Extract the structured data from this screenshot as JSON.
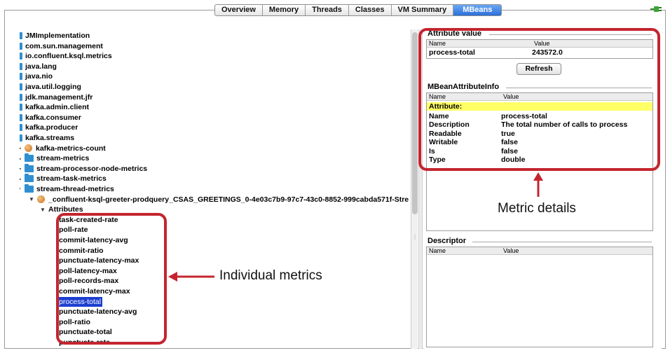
{
  "tabs": [
    {
      "label": "Overview",
      "active": false
    },
    {
      "label": "Memory",
      "active": false
    },
    {
      "label": "Threads",
      "active": false
    },
    {
      "label": "Classes",
      "active": false
    },
    {
      "label": "VM Summary",
      "active": false
    },
    {
      "label": "MBeans",
      "active": true
    }
  ],
  "tree": {
    "domains": [
      "JMImplementation",
      "com.sun.management",
      "io.confluent.ksql.metrics",
      "java.lang",
      "java.nio",
      "java.util.logging",
      "jdk.management.jfr",
      "kafka.admin.client",
      "kafka.consumer",
      "kafka.producer"
    ],
    "expanded_domain": "kafka.streams",
    "children": [
      {
        "label": "kafka-metrics-count",
        "icon": "bean-icon"
      },
      {
        "label": "stream-metrics",
        "icon": "folder-icon"
      },
      {
        "label": "stream-processor-node-metrics",
        "icon": "folder-icon"
      },
      {
        "label": "stream-task-metrics",
        "icon": "folder-icon"
      }
    ],
    "expanded_child": "stream-thread-metrics",
    "thread_bean": "_confluent-ksql-greeter-prodquery_CSAS_GREETINGS_0-4e03c7b9-97c7-43c0-8852-999cabda571f-Stre",
    "attributes_node": "Attributes",
    "attributes": [
      "task-created-rate",
      "poll-rate",
      "commit-latency-avg",
      "commit-ratio",
      "punctuate-latency-max",
      "poll-latency-max",
      "poll-records-max",
      "commit-latency-max",
      "process-total",
      "punctuate-latency-avg",
      "poll-ratio",
      "punctuate-total",
      "punctuate-rate"
    ],
    "selected_attribute": "process-total"
  },
  "attribute_value": {
    "title": "Attribute value",
    "col_name": "Name",
    "col_value": "Value",
    "name": "process-total",
    "value": "243572.0",
    "refresh_label": "Refresh"
  },
  "attribute_info": {
    "title": "MBeanAttributeInfo",
    "col_name": "Name",
    "col_value": "Value",
    "section": "Attribute:",
    "rows": [
      {
        "name": "Name",
        "value": "process-total"
      },
      {
        "name": "Description",
        "value": "The total number of calls to process"
      },
      {
        "name": "Readable",
        "value": "true"
      },
      {
        "name": "Writable",
        "value": "false"
      },
      {
        "name": "Is",
        "value": "false"
      },
      {
        "name": "Type",
        "value": "double"
      }
    ]
  },
  "descriptor": {
    "title": "Descriptor",
    "col_name": "Name",
    "col_value": "Value"
  },
  "annotations": {
    "metric_details": "Metric details",
    "individual_metrics": "Individual metrics",
    "color": "#c4252f"
  },
  "colors": {
    "selection": "#1d3fd0",
    "highlight": "#ffff66",
    "folder": "#2f8fd0",
    "tab_active": "#2b6fd8"
  }
}
